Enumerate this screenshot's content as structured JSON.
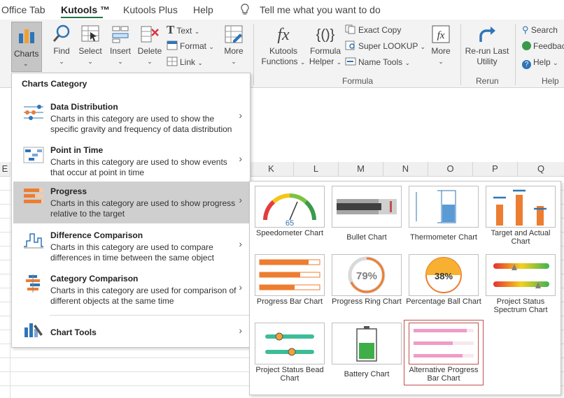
{
  "tabs": [
    {
      "label": "Office Tab",
      "active": false
    },
    {
      "label": "Kutools ™",
      "active": true
    },
    {
      "label": "Kutools Plus",
      "active": false
    },
    {
      "label": "Help",
      "active": false
    }
  ],
  "tell_me": "Tell me what you want to do",
  "ribbon": {
    "charts": "Charts",
    "find": "Find",
    "select": "Select",
    "insert": "Insert",
    "delete": "Delete",
    "text": "Text",
    "format": "Format",
    "link": "Link",
    "more1": "More",
    "kutools_functions": "Kutools Functions",
    "formula_helper": "Formula Helper",
    "exact_copy": "Exact Copy",
    "super_lookup": "Super LOOKUP",
    "name_tools": "Name Tools",
    "more2": "More",
    "rerun": "Re-run Last Utility",
    "search": "Search",
    "feedback": "Feedbac",
    "help": "Help",
    "group_formula": "Formula",
    "group_rerun": "Rerun",
    "group_help": "Help"
  },
  "columns": [
    "E",
    "K",
    "L",
    "M",
    "N",
    "O",
    "P",
    "Q"
  ],
  "menu": {
    "header": "Charts Category",
    "items": [
      {
        "title": "Data Distribution",
        "desc": "Charts in this category are used to show the specific gravity and frequency of data distribution",
        "icon": "data-distribution-icon"
      },
      {
        "title": "Point in Time",
        "desc": "Charts in this category are used to show events that occur at point in time",
        "icon": "point-in-time-icon"
      },
      {
        "title": "Progress",
        "desc": "Charts in this category are used to show progress relative to the target",
        "icon": "progress-icon",
        "selected": true
      },
      {
        "title": "Difference Comparison",
        "desc": "Charts in this category are used to compare differences in time between the same object",
        "icon": "difference-comparison-icon"
      },
      {
        "title": "Category Comparison",
        "desc": "Charts in this category are used for comparison of different objects at the same time",
        "icon": "category-comparison-icon"
      }
    ],
    "tools": "Chart Tools"
  },
  "submenu": {
    "cards": [
      {
        "label": "Speedometer Chart",
        "value": "65"
      },
      {
        "label": "Bullet Chart"
      },
      {
        "label": "Thermometer Chart"
      },
      {
        "label": "Target and Actual Chart"
      },
      {
        "label": "Progress Bar Chart"
      },
      {
        "label": "Progress Ring Chart",
        "value": "79%"
      },
      {
        "label": "Percentage Ball Chart",
        "value": "38%"
      },
      {
        "label": "Project Status Spectrum Chart"
      },
      {
        "label": "Project Status Bead Chart"
      },
      {
        "label": "Battery Chart"
      },
      {
        "label": "Alternative Progress Bar Chart",
        "highlighted": true
      }
    ]
  },
  "colors": {
    "accent": "#217346",
    "orange": "#ed7d31",
    "blue": "#2e75b6",
    "highlight": "#c0504d"
  }
}
